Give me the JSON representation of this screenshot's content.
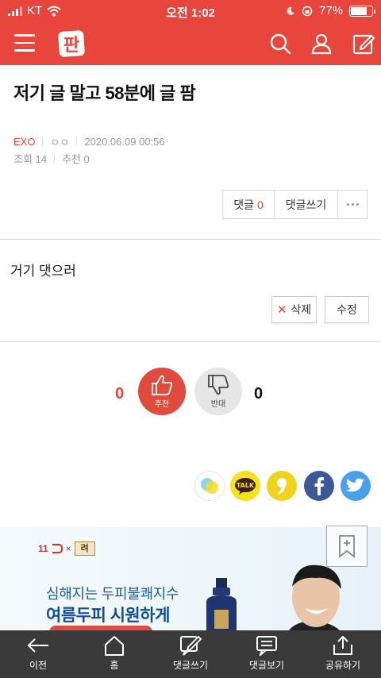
{
  "status_bar": {
    "carrier": "KT",
    "time": "오전 1:02",
    "battery_percent": "77%",
    "battery_level": 0.77
  },
  "header": {
    "logo_text": "판",
    "icons": [
      "menu-icon",
      "search-icon",
      "user-icon",
      "write-icon"
    ]
  },
  "post": {
    "title": "저기 글 말고 58분에 글 팜",
    "category": "EXO",
    "author": "ㅇㅇ",
    "datetime": "2020.06.09 00:56",
    "views_label": "조회 14",
    "recommend_label": "추천 0",
    "body": "거기 댓으러"
  },
  "comment_bar": {
    "comments_label": "댓글",
    "comments_count": "0",
    "write_label": "댓글쓰기"
  },
  "actions": {
    "delete_label": "삭제",
    "edit_label": "수정"
  },
  "vote": {
    "up_count": "0",
    "up_label": "추천",
    "down_count": "0",
    "down_label": "반대"
  },
  "share": {
    "talk_label": "TALK"
  },
  "ad": {
    "brand_text": "11",
    "brand_box": "려",
    "line1": "심해지는 두피불쾌지수",
    "line2": "여름두피 시원하게"
  },
  "bottom_nav": [
    {
      "label": "이전",
      "icon": "back-arrow-icon"
    },
    {
      "label": "홈",
      "icon": "home-icon"
    },
    {
      "label": "댓글쓰기",
      "icon": "compose-icon"
    },
    {
      "label": "댓글보기",
      "icon": "comment-view-icon"
    },
    {
      "label": "공유하기",
      "icon": "share-icon"
    }
  ],
  "colors": {
    "brand_red": "#e8453c",
    "bottom_bar": "#3a3a3a"
  }
}
